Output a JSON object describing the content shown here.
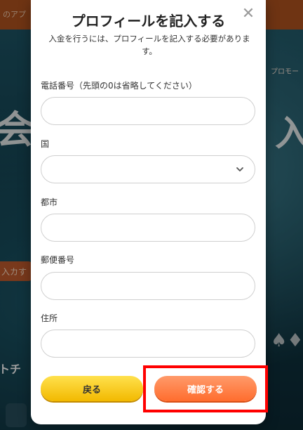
{
  "background": {
    "top_text": "のアプ",
    "right_label": "プロモー",
    "big_left": "会",
    "big_right": "入",
    "left_pill": "入カす",
    "bottom_left": "トチ"
  },
  "modal": {
    "title": "プロフィールを記入する",
    "description": "入金を行うには、プロフィールを記入する必要があります。",
    "fields": {
      "phone_label": "電話番号（先頭の0は省略してください）",
      "phone_value": "",
      "country_label": "国",
      "country_value": "",
      "city_label": "都市",
      "city_value": "",
      "postal_label": "郵便番号",
      "postal_value": "",
      "address_label": "住所",
      "address_value": ""
    },
    "buttons": {
      "back": "戻る",
      "confirm": "確認する"
    }
  },
  "colors": {
    "back_button": "#f2b900",
    "confirm_button": "#ff6d2e",
    "highlight": "#ff0000"
  },
  "icons": {
    "close": "close-icon",
    "select_arrow": "chevron-down-icon"
  }
}
